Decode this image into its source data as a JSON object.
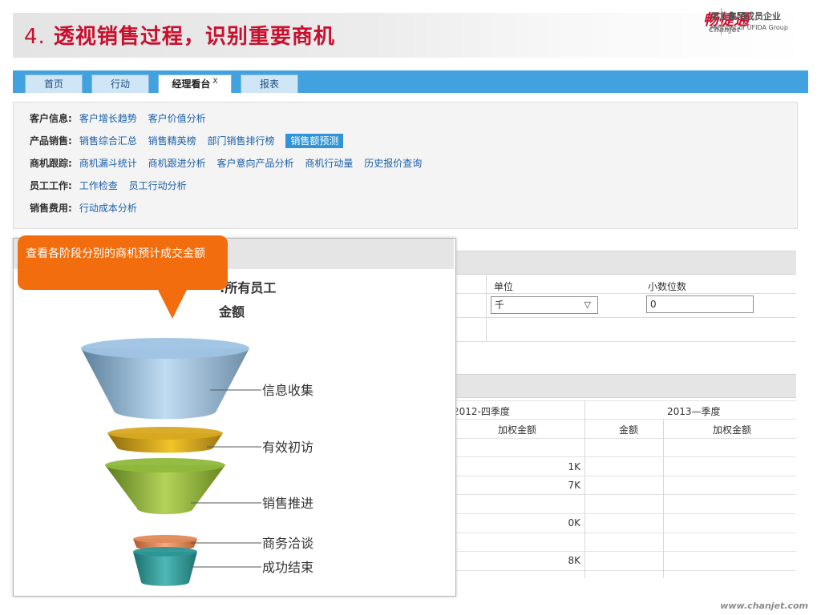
{
  "slide": {
    "title_number": "4.",
    "title_text": "透视销售过程，识别重要商机",
    "brand_logo_text": "畅捷通",
    "brand_logo_sub": "Chanjet",
    "group_text_cn": "用友集团成员企业",
    "group_text_en": "Member of UFIDA Group",
    "footer_url": "www.chanjet.com"
  },
  "nav": {
    "tabs": [
      {
        "label": "首页"
      },
      {
        "label": "行动"
      },
      {
        "label": "经理看台",
        "close": "X"
      },
      {
        "label": "报表"
      }
    ]
  },
  "categories": [
    {
      "label": "客户信息:",
      "links": [
        "客户增长趋势",
        "客户价值分析"
      ]
    },
    {
      "label": "产品销售:",
      "links": [
        "销售综合汇总",
        "销售精英榜",
        "部门销售排行榜",
        "销售额预测"
      ]
    },
    {
      "label": "商机跟踪:",
      "links": [
        "商机漏斗统计",
        "商机跟进分析",
        "客户意向产品分析",
        "商机行动量",
        "历史报价查询"
      ]
    },
    {
      "label": "员工工作:",
      "links": [
        "工作检查",
        "员工行动分析"
      ]
    },
    {
      "label": "销售费用:",
      "links": [
        "行动成本分析"
      ]
    }
  ],
  "params": {
    "unit_label": "单位",
    "unit_value": "千",
    "decimal_label": "小数位数",
    "decimal_value": "0"
  },
  "table": {
    "period1": "2012-四季度",
    "period2": "2013—季度",
    "col_weighted": "加权金额",
    "col_amount": "金额",
    "col_weighted2": "加权金额",
    "values": [
      "1K",
      "7K",
      "0K",
      "8K"
    ]
  },
  "chart": {
    "title_line1": ":所有员工",
    "title_line2": "金额"
  },
  "callout": {
    "text": "查看各阶段分别的商机预计成交金额"
  },
  "chart_data": {
    "type": "funnel",
    "stages": [
      "信息收集",
      "有效初访",
      "销售推进",
      "商务洽谈",
      "成功结束"
    ],
    "colors": [
      "#9fc3e4",
      "#d7a820",
      "#8fb83a",
      "#e08a5a",
      "#2c9694"
    ]
  }
}
